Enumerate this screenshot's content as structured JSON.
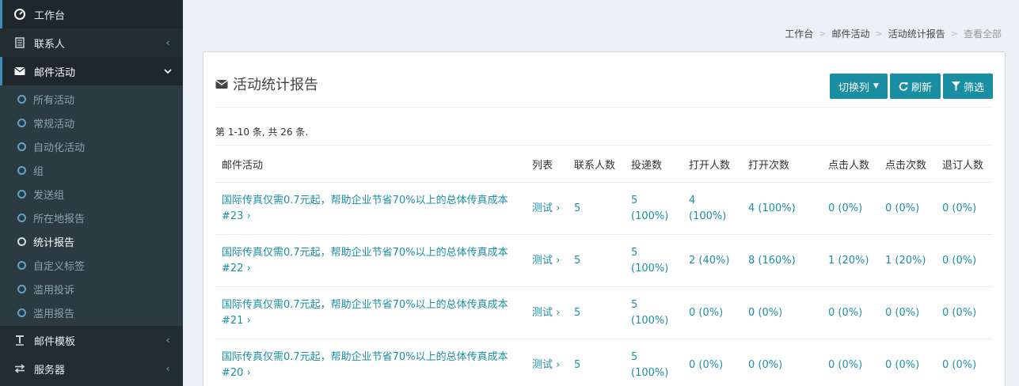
{
  "sidebar": {
    "dashboard": "工作台",
    "contacts": "联系人",
    "campaigns": "邮件活动",
    "sub": [
      "所有活动",
      "常规活动",
      "自动化活动",
      "组",
      "发送组",
      "所在地报告",
      "统计报告",
      "自定义标签",
      "滥用投诉",
      "滥用报告"
    ],
    "templates": "邮件模板",
    "servers": "服务器",
    "arrow_left": "‹",
    "arrow_down": "⌄"
  },
  "breadcrumb": [
    "工作台",
    "邮件活动",
    "活动统计报告",
    "查看全部"
  ],
  "breadcrumb_sep": ">",
  "box": {
    "title": "活动统计报告",
    "toggle_columns": "切换列",
    "refresh": "刷新",
    "filter": "筛选",
    "summary": "第 1-10 条, 共 26 条."
  },
  "table": {
    "headers": [
      "邮件活动",
      "列表",
      "联系人数",
      "投递数",
      "打开人数",
      "打开次数",
      "点击人数",
      "点击次数",
      "退订人数"
    ],
    "rows": [
      {
        "name": "国际传真仅需0.7元起，帮助企业节省70%以上的总体传真成本 #23 ›",
        "list": "测试 ›",
        "contacts": "5",
        "delivered": "5 (100%)",
        "opens": "4 (100%)",
        "open_count": "4 (100%)",
        "clicks": "0 (0%)",
        "click_count": "0 (0%)",
        "unsubs": "0 (0%)"
      },
      {
        "name": "国际传真仅需0.7元起，帮助企业节省70%以上的总体传真成本 #22 ›",
        "list": "测试 ›",
        "contacts": "5",
        "delivered": "5 (100%)",
        "opens": "2 (40%)",
        "open_count": "8 (160%)",
        "clicks": "1 (20%)",
        "click_count": "1 (20%)",
        "unsubs": "0 (0%)"
      },
      {
        "name": "国际传真仅需0.7元起，帮助企业节省70%以上的总体传真成本 #21 ›",
        "list": "测试 ›",
        "contacts": "5",
        "delivered": "5 (100%)",
        "opens": "0 (0%)",
        "open_count": "0 (0%)",
        "clicks": "0 (0%)",
        "click_count": "0 (0%)",
        "unsubs": "0 (0%)"
      },
      {
        "name": "国际传真仅需0.7元起，帮助企业节省70%以上的总体传真成本 #20 ›",
        "list": "测试 ›",
        "contacts": "5",
        "delivered": "5 (100%)",
        "opens": "0 (0%)",
        "open_count": "0 (0%)",
        "clicks": "0 (0%)",
        "click_count": "0 (0%)",
        "unsubs": "0 (0%)"
      }
    ]
  },
  "colors": {
    "accent": "#1a8fa3",
    "sidebar": "#222d32",
    "active_border": "#3c8dbc"
  }
}
